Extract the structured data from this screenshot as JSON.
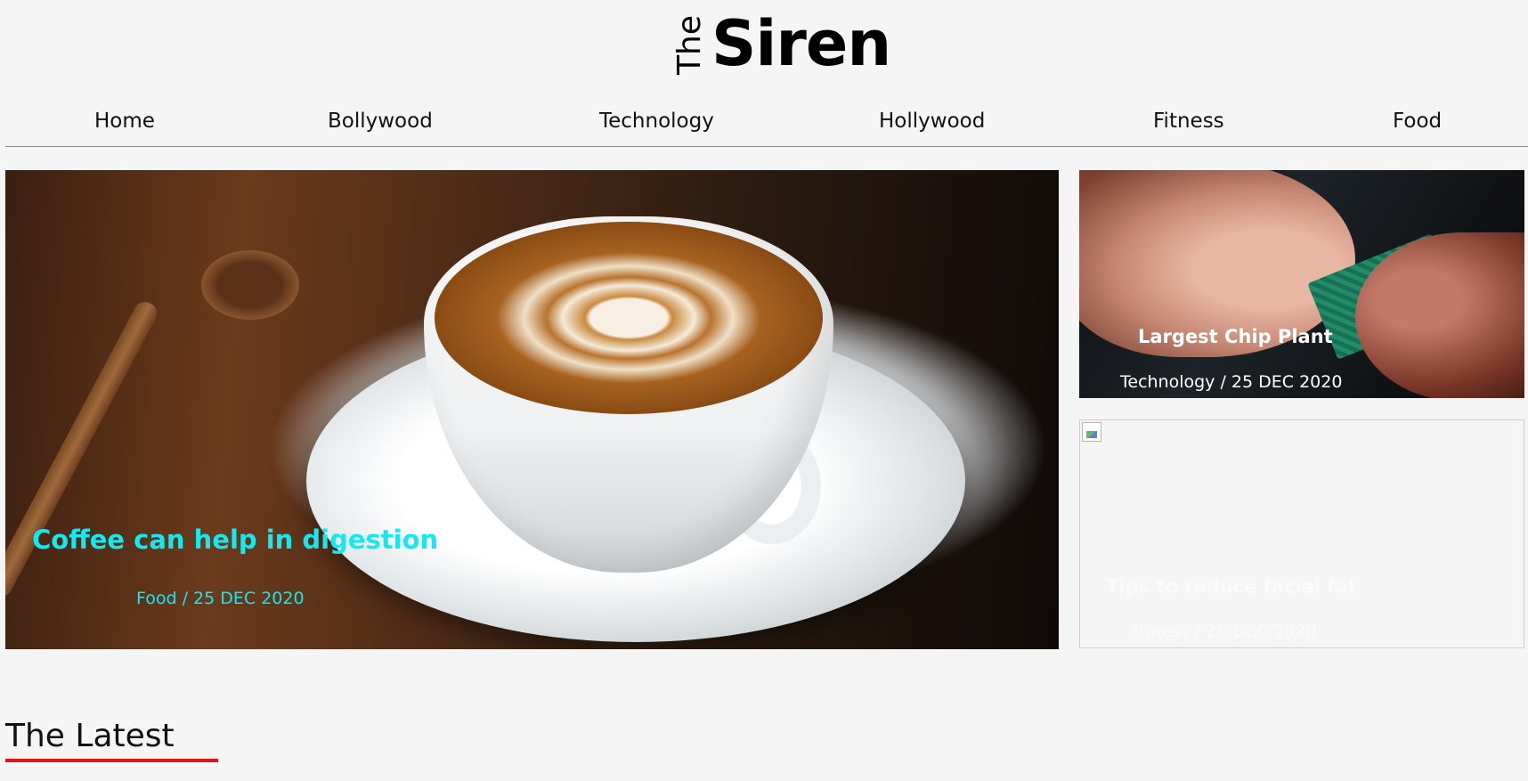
{
  "logo": {
    "prefix": "The",
    "name": "Siren"
  },
  "nav": {
    "items": [
      {
        "label": "Home"
      },
      {
        "label": "Bollywood"
      },
      {
        "label": "Technology"
      },
      {
        "label": "Hollywood"
      },
      {
        "label": "Fitness"
      },
      {
        "label": "Food"
      }
    ]
  },
  "featured": {
    "main": {
      "title": "Coffee can help in digestion",
      "meta": "Food / 25 DEC 2020",
      "accent_color": "#14e8f0"
    },
    "side": [
      {
        "title": "Largest Chip Plant",
        "meta": "Technology / 25 DEC 2020",
        "text_color": "#ffffff"
      },
      {
        "title": "Tips to reduce facial fat",
        "meta": "Fitness / 25 DEC 2020",
        "text_color": "#fafafa"
      }
    ]
  },
  "section": {
    "title": "The Latest",
    "underline_color": "#dd1515"
  }
}
